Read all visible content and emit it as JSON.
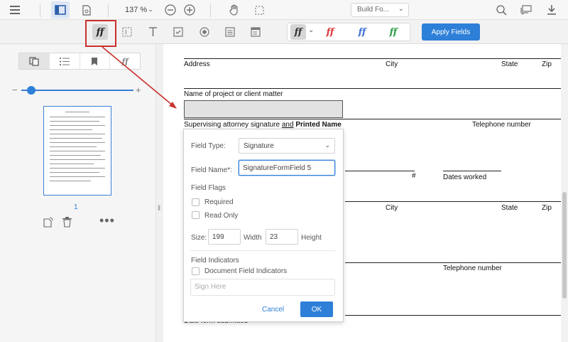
{
  "top_toolbar": {
    "zoom": "137 %",
    "build_select": "Build Fo...",
    "icons": [
      "menu-icon",
      "panel-icon",
      "page-settings-icon",
      "zoom-out-icon",
      "zoom-in-icon",
      "hand-icon",
      "select-icon",
      "search-icon",
      "comment-icon",
      "download-icon"
    ]
  },
  "form_toolbar": {
    "tools": [
      "signature-field-icon",
      "text-field-icon",
      "text-icon",
      "checkbox-icon",
      "radio-icon",
      "list-icon",
      "dropdown-icon"
    ],
    "signature_glyph": "ﬀ",
    "colors": [
      "#333333",
      "#d9383a",
      "#3b6fd6",
      "#2e9b4a"
    ],
    "apply_label": "Apply Fields"
  },
  "sidebar": {
    "tabs": [
      "thumbnails-icon",
      "outline-icon",
      "bookmark-icon",
      "signature-icon"
    ],
    "page_label": "1"
  },
  "document": {
    "row1": {
      "address": "Address",
      "city": "City",
      "state": "State",
      "zip": "Zip"
    },
    "project_label": "Name of project or client matter",
    "supervising_label": "Supervising attorney signature",
    "and_word": "and",
    "printed_name": "Printed Name",
    "telephone": "Telephone number",
    "dates_worked": "Dates worked",
    "row2": {
      "city": "City",
      "state": "State",
      "zip": "Zip"
    },
    "telephone2": "Telephone number",
    "hash": "#",
    "bottom_cut": "Date form submitted"
  },
  "dialog": {
    "field_type_label": "Field Type:",
    "field_type_value": "Signature",
    "field_name_label": "Field Name*:",
    "field_name_value": "SignatureFormField 5",
    "field_flags": "Field Flags",
    "required": "Required",
    "read_only": "Read Only",
    "size_label": "Size:",
    "size_value": "199",
    "width_label": "Width",
    "width_value": "23",
    "height_label": "Height",
    "indicators_label": "Field Indicators",
    "doc_indicators": "Document Field Indicators",
    "sign_here_placeholder": "Sign Here",
    "cancel": "Cancel",
    "ok": "OK"
  }
}
